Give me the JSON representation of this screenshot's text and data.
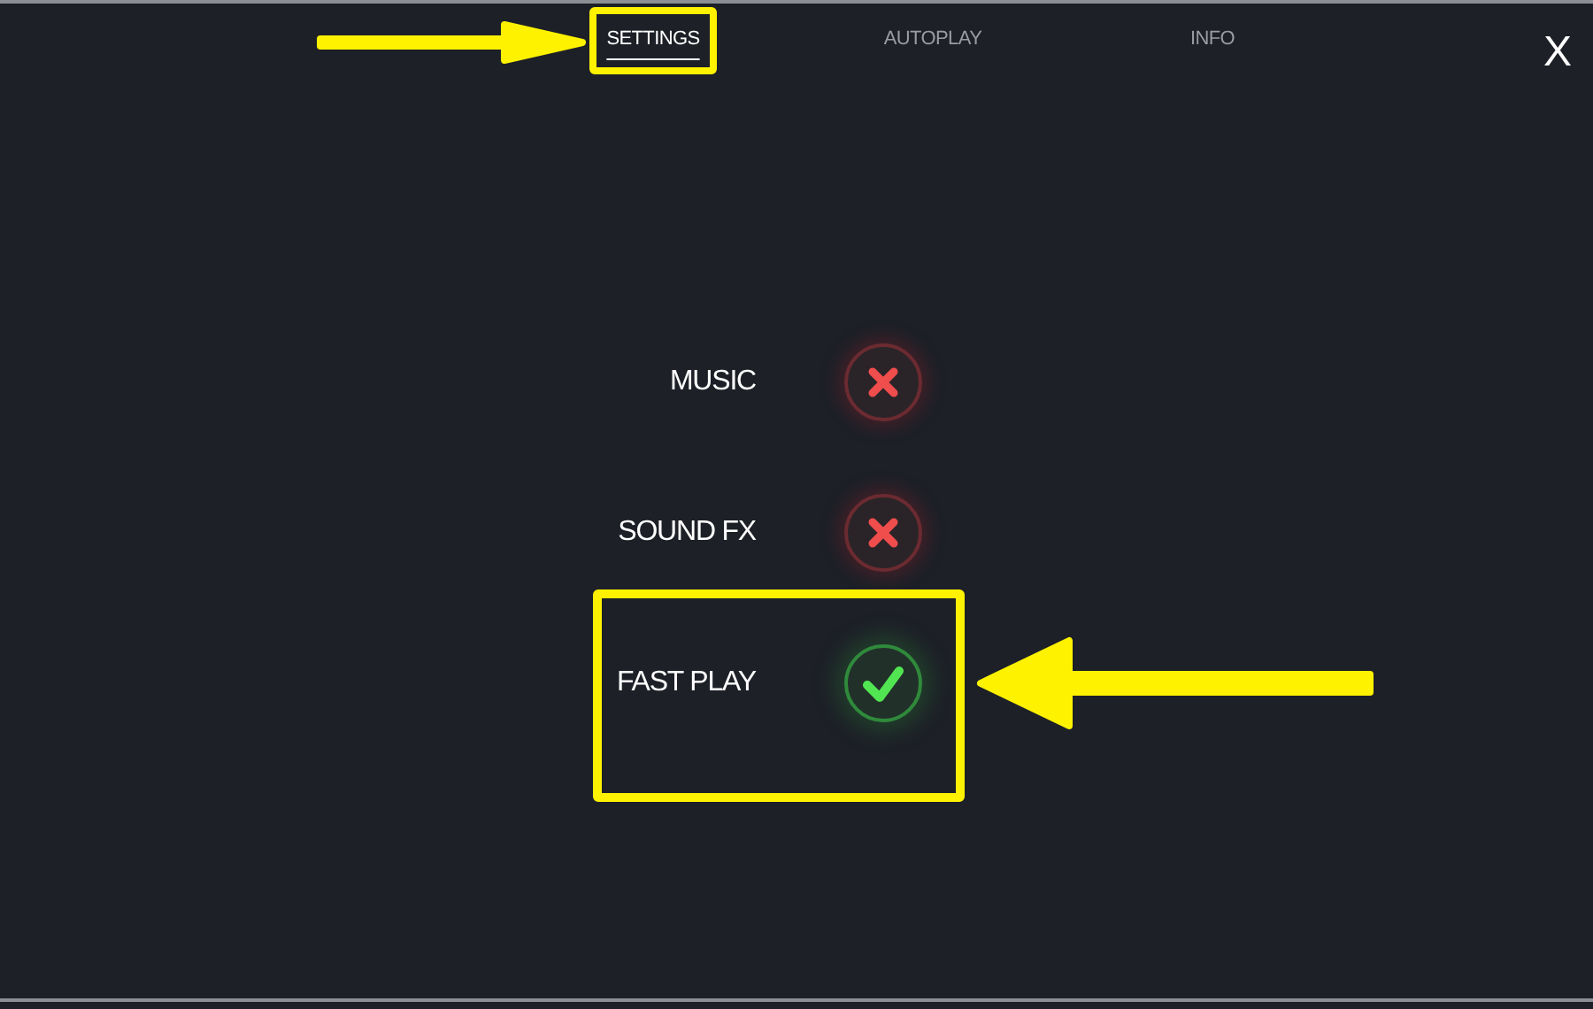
{
  "tabs": [
    {
      "label": "SETTINGS",
      "selected": true,
      "highlighted": true
    },
    {
      "label": "AUTOPLAY",
      "selected": false,
      "highlighted": false
    },
    {
      "label": "INFO",
      "selected": false,
      "highlighted": false
    }
  ],
  "close": "X",
  "settings": [
    {
      "label": "MUSIC",
      "on": false,
      "highlighted": false
    },
    {
      "label": "SOUND FX",
      "on": false,
      "highlighted": false
    },
    {
      "label": "FAST PLAY",
      "on": true,
      "highlighted": true
    }
  ]
}
